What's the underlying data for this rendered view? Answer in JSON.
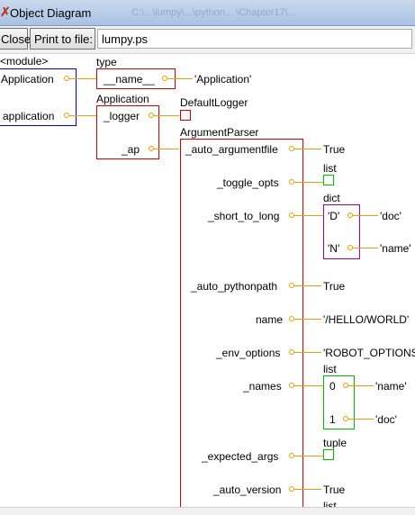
{
  "window": {
    "title": "Object Diagram",
    "path_hint": "C:\\...\\lumpy\\...\\python...  \\Chapter17\\..."
  },
  "toolbar": {
    "close_label": "Close",
    "print_label": "Print to file:",
    "filename": "lumpy.ps"
  },
  "diagram": {
    "module": {
      "header": "<module>",
      "var1": "Application",
      "var2": "application"
    },
    "type_frame": {
      "header": "type",
      "attr": "__name__",
      "value": "'Application'"
    },
    "app_frame": {
      "header": "Application",
      "logger": "_logger",
      "ap": "_ap"
    },
    "logger_frame": {
      "header": "DefaultLogger"
    },
    "argparser": {
      "header": "ArgumentParser",
      "attrs": [
        {
          "name": "_auto_argumentfile",
          "value": "True"
        },
        {
          "name": "_toggle_opts",
          "value": ""
        },
        {
          "name": "_short_to_long",
          "value": ""
        },
        {
          "name": "_auto_pythonpath",
          "value": "True"
        },
        {
          "name": "name",
          "value": "'/HELLO/WORLD'"
        },
        {
          "name": "_env_options",
          "value": "'ROBOT_OPTIONS'"
        },
        {
          "name": "_names",
          "value": ""
        },
        {
          "name": "_expected_args",
          "value": ""
        },
        {
          "name": "_auto_version",
          "value": "True"
        }
      ]
    },
    "toggle_list": {
      "header": "list"
    },
    "dict": {
      "header": "dict",
      "k1": "'D'",
      "v1": "'doc'",
      "k2": "'N'",
      "v2": "'name'"
    },
    "names_list": {
      "header": "list",
      "i0": "0",
      "v0": "'name'",
      "i1": "1",
      "v1": "'doc'"
    },
    "tuple": {
      "header": "tuple"
    },
    "last_list": {
      "header": "list"
    }
  }
}
